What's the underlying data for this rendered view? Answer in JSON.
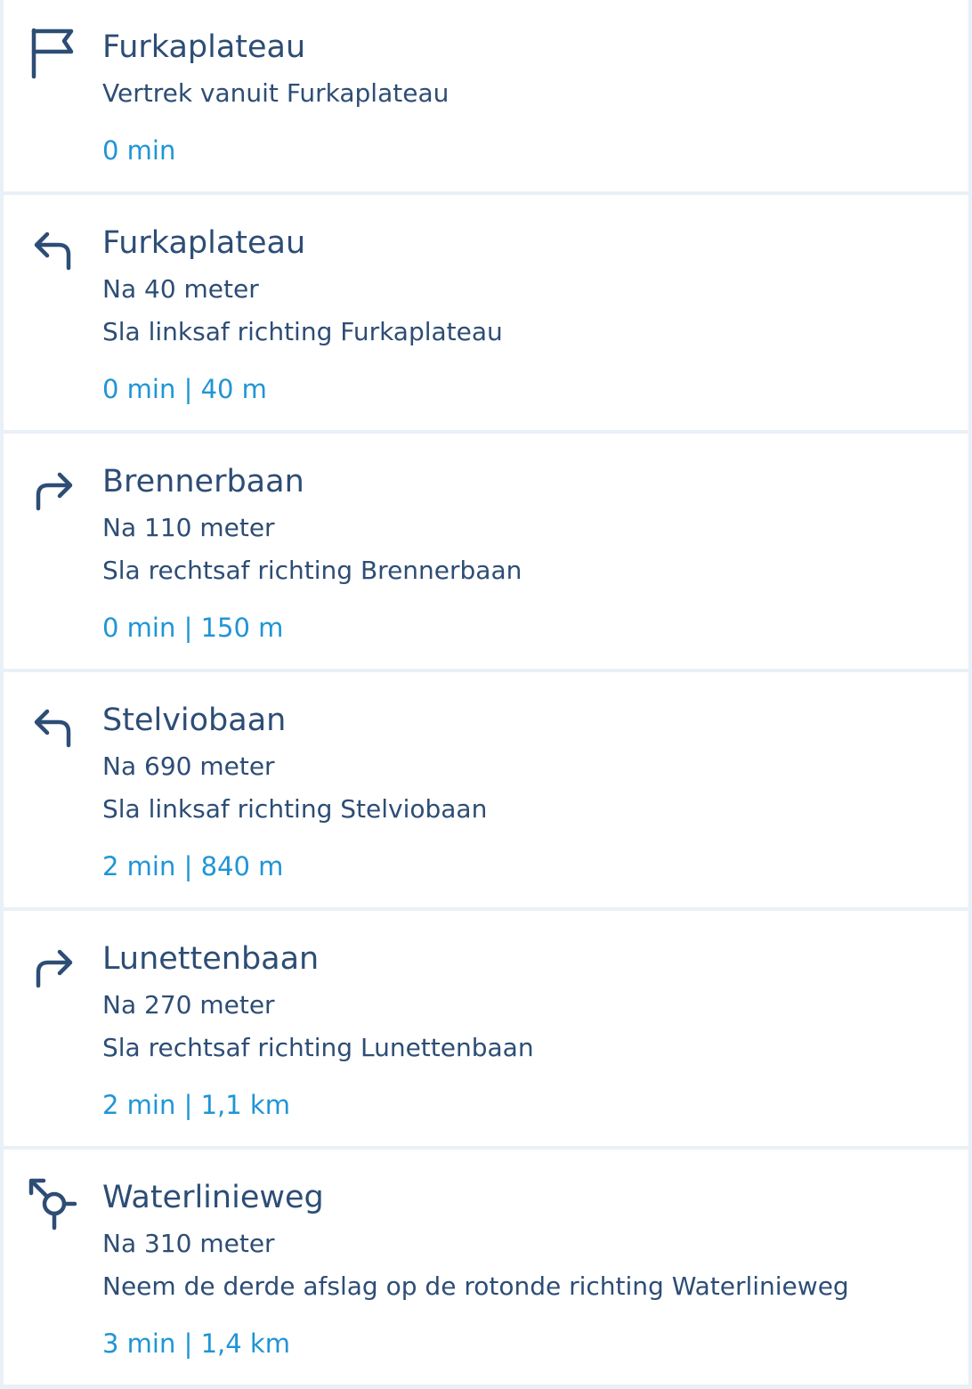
{
  "colors": {
    "text": "#2d4d75",
    "accent": "#1f95d6",
    "background": "#e9f0f6",
    "card": "#ffffff"
  },
  "steps": [
    {
      "icon": "flag-icon",
      "title": "Furkaplateau",
      "lines": [
        "Vertrek vanuit Furkaplateau"
      ],
      "meta": "0 min"
    },
    {
      "icon": "turn-left-icon",
      "title": "Furkaplateau",
      "lines": [
        "Na 40 meter",
        "Sla linksaf richting Furkaplateau"
      ],
      "meta": "0 min | 40 m"
    },
    {
      "icon": "turn-right-icon",
      "title": "Brennerbaan",
      "lines": [
        "Na 110 meter",
        "Sla rechtsaf richting Brennerbaan"
      ],
      "meta": "0 min | 150 m"
    },
    {
      "icon": "turn-left-icon",
      "title": "Stelviobaan",
      "lines": [
        "Na 690 meter",
        "Sla linksaf richting Stelviobaan"
      ],
      "meta": "2 min | 840 m"
    },
    {
      "icon": "turn-right-icon",
      "title": "Lunettenbaan",
      "lines": [
        "Na 270 meter",
        "Sla rechtsaf richting Lunettenbaan"
      ],
      "meta": "2 min | 1,1 km"
    },
    {
      "icon": "roundabout-third-exit-icon",
      "title": "Waterlinieweg",
      "lines": [
        "Na 310 meter",
        "Neem de derde afslag op de rotonde richting Waterlinieweg"
      ],
      "meta": "3 min | 1,4 km"
    }
  ]
}
